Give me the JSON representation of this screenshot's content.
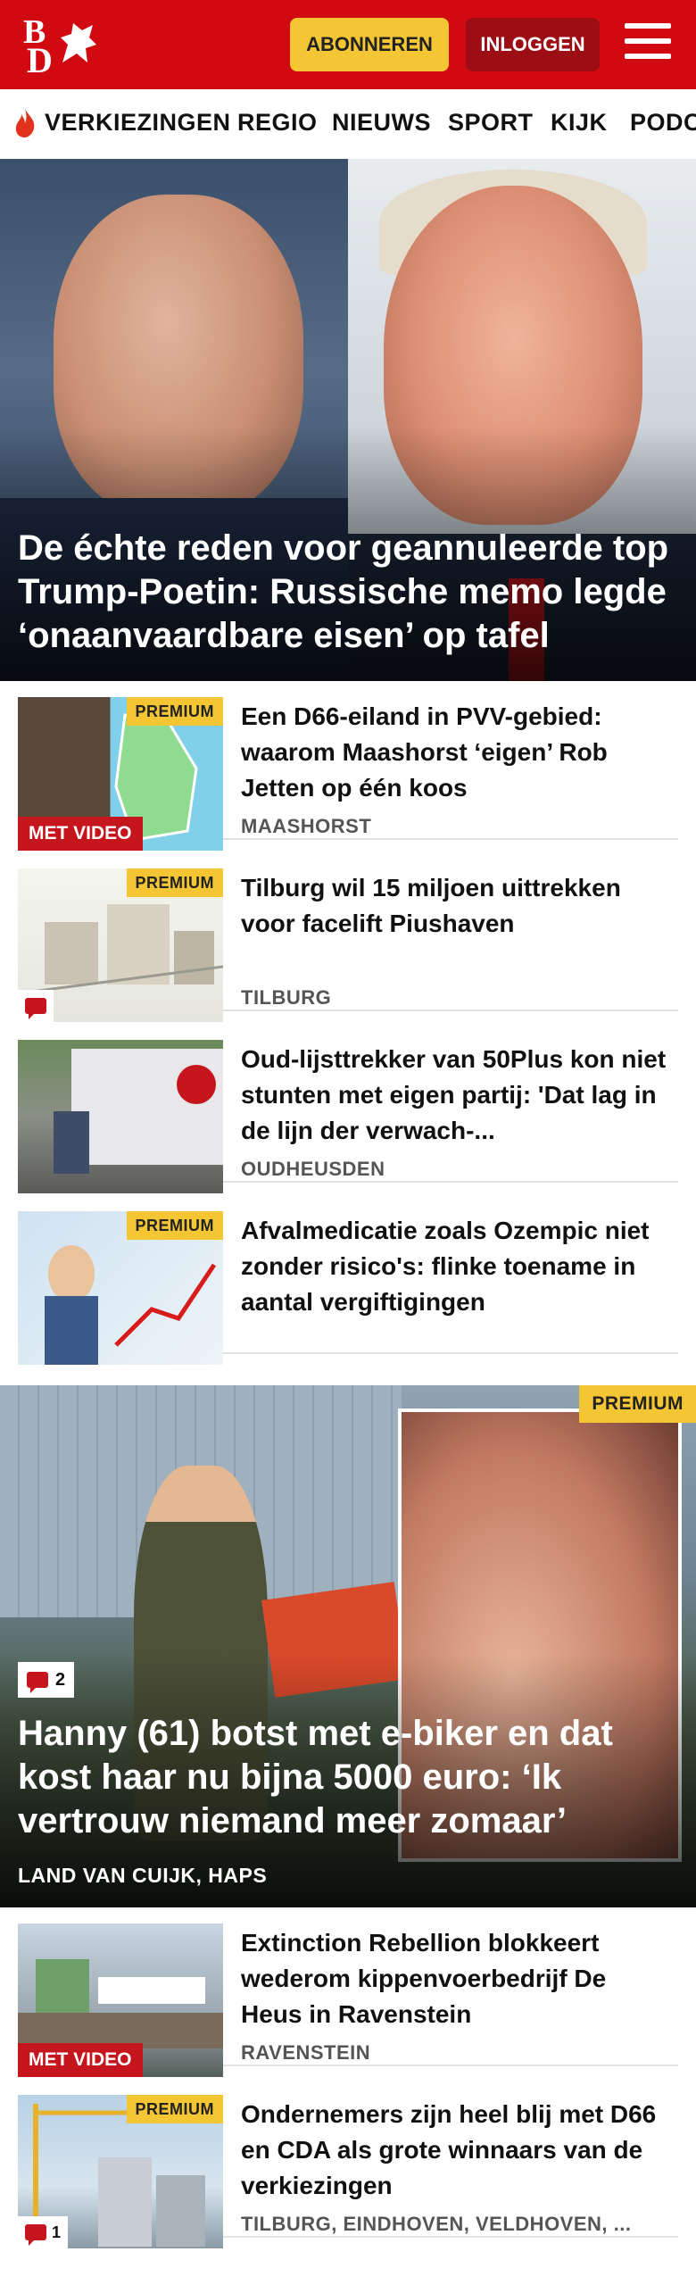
{
  "header": {
    "logo_text_top": "B",
    "logo_text_bottom": "D",
    "subscribe_label": "ABONNEREN",
    "login_label": "INLOGGEN"
  },
  "nav": {
    "items": [
      "VERKIEZINGEN",
      "REGIO",
      "NIEUWS",
      "SPORT",
      "KIJK",
      "PODCASTS"
    ]
  },
  "hero": {
    "title": "De échte reden voor geannuleerde top Trump-Poetin: Russische memo legde ‘onaanvaardbare eisen’ op tafel"
  },
  "articles": [
    {
      "title": "Een D66-eiland in PVV-gebied: waarom Maashorst ‘eigen’ Rob Jetten op één koos",
      "location": "MAASHORST",
      "premium": "PREMIUM",
      "video": "MET VIDEO"
    },
    {
      "title": "Tilburg wil 15 miljoen uittrekken voor facelift Piushaven",
      "location": "TILBURG",
      "premium": "PREMIUM",
      "comments": ""
    },
    {
      "title": "Oud-lijsttrekker van 50Plus kon niet stunten met eigen partij: 'Dat lag in de lijn der verwach-...",
      "location": "OUDHEUSDEN"
    },
    {
      "title": "Afvalmedicatie zoals Ozempic niet zonder risico's: flinke toename in aantal vergiftigingen",
      "location": "",
      "premium": "PREMIUM"
    }
  ],
  "feature": {
    "premium": "PREMIUM",
    "comments": "2",
    "title": "Hanny (61) botst met e-biker en dat kost haar nu bijna 5000 euro: ‘Ik vertrouw niemand meer zomaar’",
    "location": "LAND VAN CUIJK, HAPS"
  },
  "articles2": [
    {
      "title": "Extinction Rebellion blokkeert wederom kippenvoerbedrijf De Heus in Ravenstein",
      "location": "RAVENSTEIN",
      "video": "MET VIDEO"
    },
    {
      "title": "Ondernemers zijn heel blij met D66 en CDA als grote winnaars van de verkiezingen",
      "location": "TILBURG, EINDHOVEN, VELDHOVEN, ...",
      "premium": "PREMIUM",
      "comments": "1"
    }
  ],
  "colors": {
    "brand_red": "#d10a11",
    "premium_yellow": "#f5c634",
    "dark_red": "#9d0e14"
  }
}
